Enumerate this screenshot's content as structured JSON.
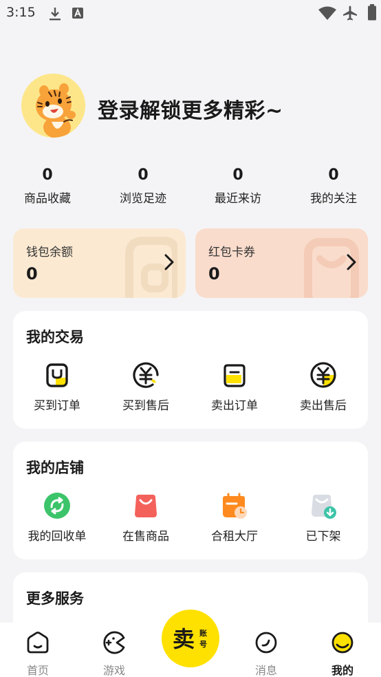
{
  "status_bar": {
    "time": "3:15",
    "left_icons": [
      "download-icon",
      "keyboard-a-icon"
    ],
    "right_icons": [
      "wifi-icon",
      "airplane-icon",
      "battery-icon"
    ]
  },
  "profile": {
    "login_prompt": "登录解锁更多精彩~",
    "avatar": "tiger-mascot"
  },
  "stats": [
    {
      "value": "0",
      "label": "商品收藏"
    },
    {
      "value": "0",
      "label": "浏览足迹"
    },
    {
      "value": "0",
      "label": "最近来访"
    },
    {
      "value": "0",
      "label": "我的关注"
    }
  ],
  "wallet": {
    "title": "钱包余额",
    "amount": "0",
    "bg_color": "#fbe9d2"
  },
  "coupons": {
    "title": "红包卡券",
    "amount": "0",
    "bg_color": "#fadccc"
  },
  "trades": {
    "title": "我的交易",
    "items": [
      {
        "label": "买到订单",
        "icon": "bought-orders-icon"
      },
      {
        "label": "买到售后",
        "icon": "bought-aftersale-icon"
      },
      {
        "label": "卖出订单",
        "icon": "sold-orders-icon"
      },
      {
        "label": "卖出售后",
        "icon": "sold-aftersale-icon"
      }
    ]
  },
  "shop": {
    "title": "我的店铺",
    "items": [
      {
        "label": "我的回收单",
        "icon": "recycle-order-icon",
        "color": "#3cc46a"
      },
      {
        "label": "在售商品",
        "icon": "on-sale-bag-icon",
        "color": "#f4615b"
      },
      {
        "label": "合租大厅",
        "icon": "rent-calendar-icon",
        "color": "#ff8a1f"
      },
      {
        "label": "已下架",
        "icon": "delisted-icon",
        "color": "#3cc4a8"
      }
    ]
  },
  "more": {
    "title": "更多服务"
  },
  "bottom_nav": {
    "items": [
      {
        "label": "首页",
        "icon": "home-icon"
      },
      {
        "label": "游戏",
        "icon": "game-icon"
      },
      {
        "label": "消息",
        "icon": "message-icon"
      },
      {
        "label": "我的",
        "icon": "profile-icon"
      }
    ],
    "active": "我的",
    "sell": {
      "main": "卖",
      "sub1": "账",
      "sub2": "号",
      "color": "#ffe100"
    }
  },
  "colors": {
    "accent": "#ffe100",
    "background": "#f4f4f6"
  }
}
